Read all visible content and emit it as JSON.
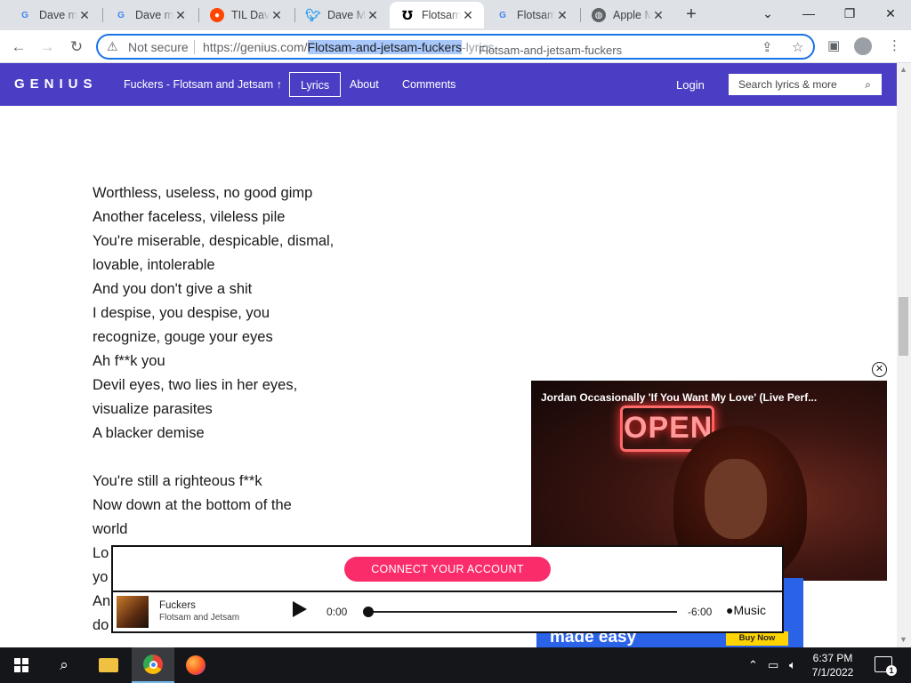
{
  "browser": {
    "tabs": [
      {
        "title": "Dave m",
        "favicon": "G",
        "close": "✕"
      },
      {
        "title": "Dave m",
        "favicon": "G",
        "close": "✕"
      },
      {
        "title": "TIL Dav",
        "favicon": "reddit",
        "close": "✕"
      },
      {
        "title": "Dave M",
        "favicon": "twitter",
        "close": "✕"
      },
      {
        "title": "Flotsam",
        "favicon": "genius",
        "close": "✕",
        "active": true
      },
      {
        "title": "Flotsam",
        "favicon": "G",
        "close": "✕"
      },
      {
        "title": "Apple M",
        "favicon": "globe",
        "close": "✕"
      }
    ],
    "new_tab": "+",
    "window_controls": {
      "list": "⌄",
      "minimize": "—",
      "restore": "❐",
      "close": "✕"
    },
    "address_bar": {
      "security": "Not secure",
      "url_prefix": "https://genius.com/",
      "url_selected": "Flotsam-and-jetsam-fuckers",
      "url_suffix": "-lyrics",
      "suggestion": "Flotsam-and-jetsam-fuckers"
    }
  },
  "genius": {
    "logo": "GENIUS",
    "song_link": "Fuckers - Flotsam and Jetsam",
    "song_link_arrow": "↑",
    "nav": {
      "lyrics": "Lyrics",
      "about": "About",
      "comments": "Comments"
    },
    "login": "Login",
    "search_placeholder": "Search lyrics & more"
  },
  "lyrics": {
    "block1": [
      "Worthless, useless, no good gimp",
      "Another faceless, vileless pile",
      "You're miserable, despicable, dismal,",
      "lovable, intolerable",
      "And you don't give a shit",
      "I despise, you despise, you",
      "recognize, gouge your eyes",
      "Ah f**k you",
      "Devil eyes, two lies in her eyes,",
      "visualize parasites",
      "A blacker demise"
    ],
    "block2": [
      "You're still a righteous f**k",
      "Now down at the bottom of the",
      "world",
      "Lo",
      "yo",
      "An",
      "do"
    ]
  },
  "video": {
    "title": "Jordan Occasionally 'If You Want My Love' (Live Perf...",
    "sign_text": "OPEN",
    "close": "✕",
    "play": "▷"
  },
  "apple_music": {
    "connect": "CONNECT YOUR ACCOUNT",
    "track_title": "Fuckers",
    "track_artist": "Flotsam and Jetsam",
    "time_elapsed": "0:00",
    "time_remaining": "-6:00",
    "progress": 0,
    "brand": "Music"
  },
  "ad": {
    "headline": "made easy",
    "button": "Buy Now"
  },
  "taskbar": {
    "time": "6:37 PM",
    "date": "7/1/2022",
    "notifications": "1"
  },
  "colors": {
    "genius_purple": "#4a3fc4",
    "connect_pink": "#fa2d6a",
    "omnibox_blue": "#1a73e8",
    "ad_blue": "#2b63e8",
    "taskbar": "#15161a"
  }
}
